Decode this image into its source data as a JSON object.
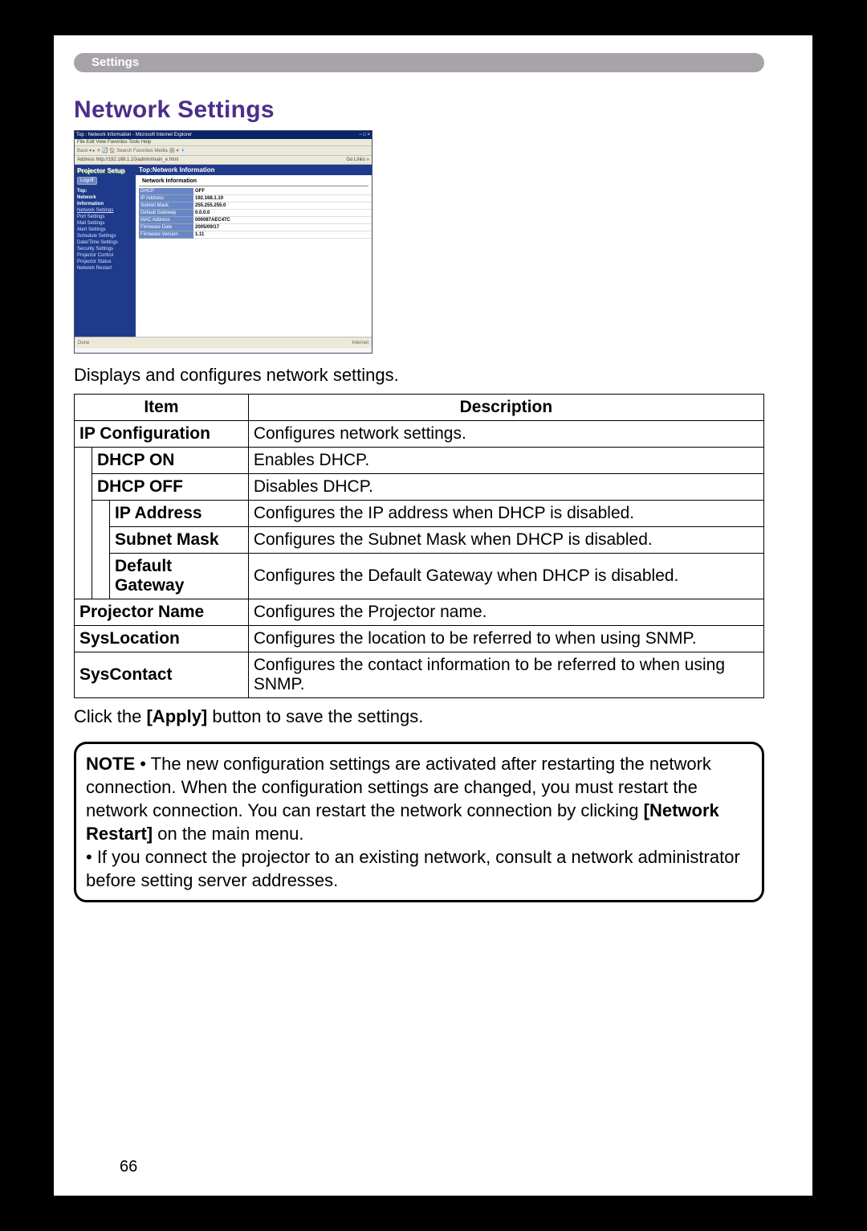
{
  "banner": "Settings",
  "heading": "Network Settings",
  "intro": "Displays and configures network settings.",
  "table": {
    "headers": {
      "item": "Item",
      "description": "Description"
    },
    "rows": [
      {
        "item": "IP Configuration",
        "desc": "Configures network settings."
      },
      {
        "item": "DHCP ON",
        "desc": "Enables DHCP."
      },
      {
        "item": "DHCP OFF",
        "desc": "Disables DHCP."
      },
      {
        "item": "IP Address",
        "desc": "Configures the IP address when DHCP is disabled."
      },
      {
        "item": "Subnet Mask",
        "desc": "Configures the Subnet Mask when DHCP is disabled."
      },
      {
        "item": "Default Gateway",
        "desc": "Configures the Default Gateway when DHCP is disabled."
      },
      {
        "item": "Projector Name",
        "desc": "Configures the Projector name."
      },
      {
        "item": "SysLocation",
        "desc": "Configures the location to be referred to when using SNMP."
      },
      {
        "item": "SysContact",
        "desc": "Configures the contact information to be referred to when using SNMP."
      }
    ]
  },
  "instruction_pre": "Click the ",
  "instruction_bold": "[Apply]",
  "instruction_post": " button to save the settings.",
  "note": {
    "label": "NOTE",
    "p1a": " • The new configuration settings are activated after restarting the network connection. When the configuration settings are changed, you must restart the network connection. You can restart the network connection by clicking ",
    "p1bold": "[Network Restart]",
    "p1b": " on the main menu.",
    "p2": "• If you connect the projector to an existing network, consult a network administrator before setting server addresses."
  },
  "page_number": "66",
  "screenshot": {
    "window_title": "Top : Network Information - Microsoft Internet Explorer",
    "menubar": "File  Edit  View  Favorites  Tools  Help",
    "toolbar": "Back ▾  ▸  ✕  🔄  🏠  Search  Favorites  Media  🖨  ▾  📧",
    "address_label": "Address",
    "address_value": "http://192.168.1.10/admin/main_e.html",
    "go": "Go  Links »",
    "sidebar": {
      "title": "Projector Setup",
      "logout": "Logoff",
      "links": [
        "Top:",
        "Network",
        "Information",
        "Network Settings",
        "Port Settings",
        "Mail Settings",
        "Alert Settings",
        "Schedule Settings",
        "Date/Time Settings",
        "Security Settings",
        "Projector Control",
        "Projector Status",
        "Network Restart"
      ]
    },
    "main": {
      "title": "Top:Network Information",
      "subtitle": "Network Information",
      "rows": [
        {
          "k": "DHCP",
          "v": "OFF"
        },
        {
          "k": "IP Address",
          "v": "192.168.1.10"
        },
        {
          "k": "Subnet Mask",
          "v": "255.255.255.0"
        },
        {
          "k": "Default Gateway",
          "v": "0.0.0.0"
        },
        {
          "k": "MAC Address",
          "v": "000087AEC47C"
        },
        {
          "k": "Firmware Date",
          "v": "2005/09/17"
        },
        {
          "k": "Firmware Version",
          "v": "1.11"
        }
      ]
    },
    "status_left": "Done",
    "status_right": "Internet"
  }
}
